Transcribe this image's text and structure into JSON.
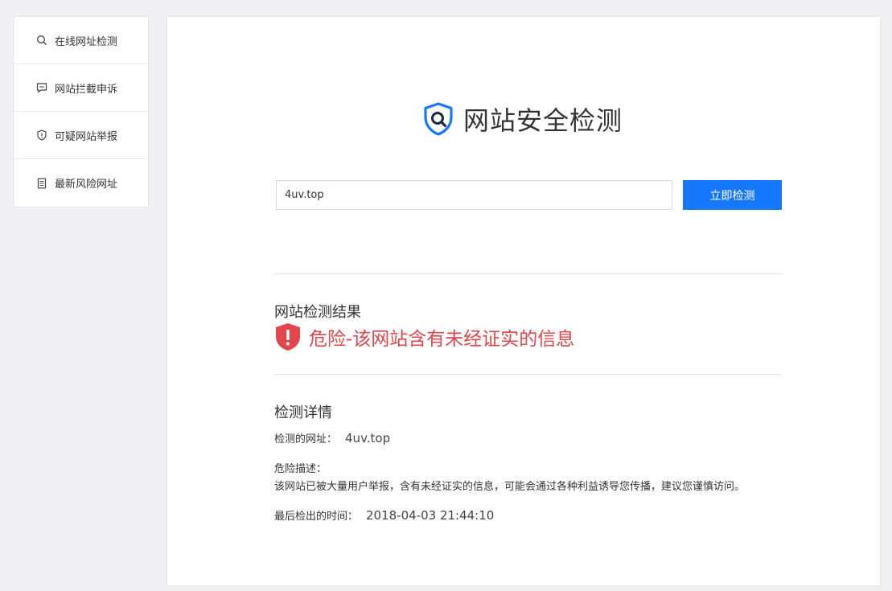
{
  "sidebar": {
    "items": [
      {
        "label": "在线网址检测",
        "icon": "search-icon"
      },
      {
        "label": "网站拦截申诉",
        "icon": "chat-icon"
      },
      {
        "label": "可疑网站举报",
        "icon": "shield-icon"
      },
      {
        "label": "最新风险网址",
        "icon": "document-icon"
      }
    ]
  },
  "header": {
    "title": "网站安全检测",
    "logo_icon": "shield-search-logo"
  },
  "search": {
    "value": "4uv.top",
    "button_label": "立即检测"
  },
  "result": {
    "heading": "网站检测结果",
    "status_text": "危险-该网站含有未经证实的信息",
    "status_color": "#e2454b",
    "status_icon": "warning-shield-icon"
  },
  "details": {
    "heading": "检测详情",
    "url_label": "检测的网址：",
    "url_value": "4uv.top",
    "description_label": "危险描述：",
    "description_text": "该网站已被大量用户举报，含有未经证实的信息，可能会通过各种利益诱导您传播，建议您谨慎访问。",
    "time_label": "最后检出的时间：",
    "time_value": "2018-04-03 21:44:10"
  },
  "colors": {
    "accent": "#1677ff",
    "danger": "#e2454b",
    "background": "#f0f0f3"
  }
}
